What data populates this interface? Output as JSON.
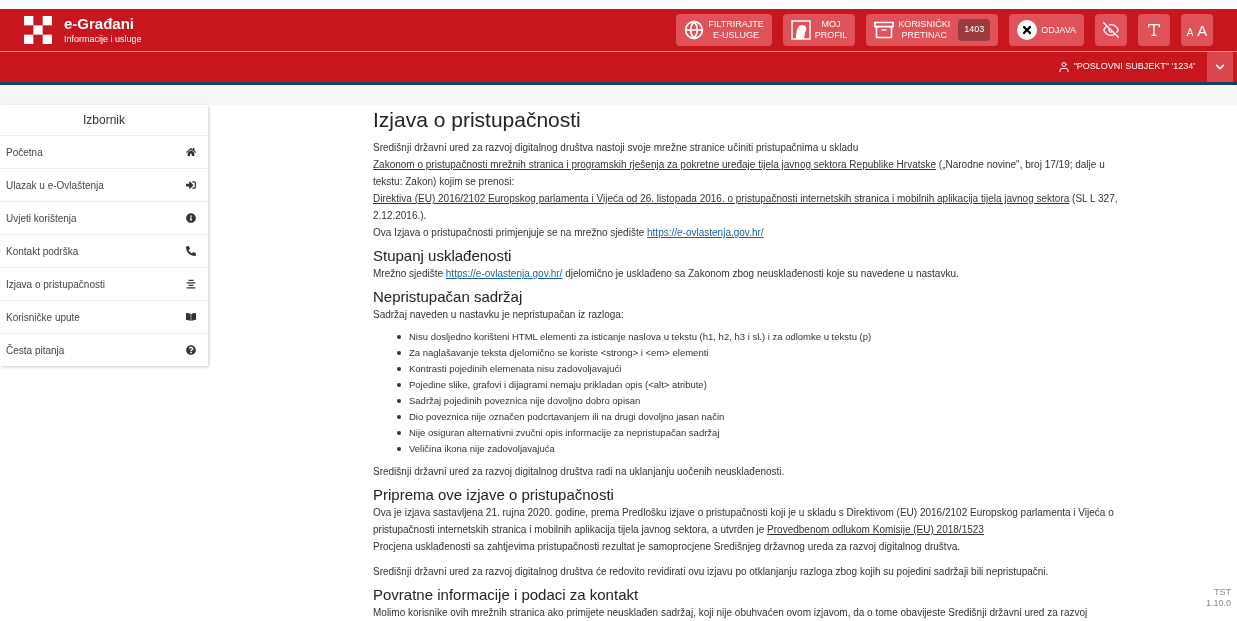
{
  "header": {
    "logo_title": "e-Građani",
    "logo_subtitle": "Informacije i usluge",
    "buttons": [
      {
        "kind": "filter",
        "lines": [
          "FILTRIRAJTE",
          "E-USLUGE"
        ]
      },
      {
        "kind": "profile",
        "lines": [
          "MOJ",
          "PROFIL"
        ]
      },
      {
        "kind": "inbox",
        "lines": [
          "KORISNIČKI",
          "PRETINAC"
        ],
        "badge": "1403"
      },
      {
        "kind": "logout",
        "lines": [
          "ODJAVA"
        ]
      },
      {
        "kind": "contrast"
      },
      {
        "kind": "font"
      },
      {
        "kind": "size",
        "small": "A",
        "large": "A"
      }
    ],
    "user": "\"POSLOVNI SUBJEKT\" '1234'"
  },
  "sidebar": {
    "title": "Izbornik",
    "items": [
      {
        "label": "Početna",
        "selected": false
      },
      {
        "label": "Ulazak u e-Ovlaštenja",
        "selected": false
      },
      {
        "label": "Uvjeti korištenja",
        "selected": false
      },
      {
        "label": "Kontakt podrška",
        "selected": false
      },
      {
        "label": "Izjava o pristupačnosti",
        "selected": false
      },
      {
        "label": "Korisničke upute",
        "selected": false
      },
      {
        "label": "Česta pitanja",
        "selected": false
      }
    ]
  },
  "content": {
    "title": "Izjava o pristupačnosti",
    "blocks": [
      {
        "kind": "para",
        "segments": [
          {
            "kind": "text",
            "text": "Središnji državni ured za razvoj digitalnog društva nastoji svoje mrežne stranice učiniti pristupačnima u skladu "
          },
          {
            "kind": "link",
            "text": "Zakonom o pristupačnosti mrežnih stranica i programskih rješenja za pokretne uređaje tijela javnog sektora Republike Hrvatske"
          },
          {
            "kind": "text",
            "text": " („Narodne novine\", broj 17/19; dalje u tekstu: Zakon) kojim se prenosi: "
          },
          {
            "kind": "link",
            "text": "Direktiva (EU) 2016/2102 Europskog parlamenta i Vijeća od 26. listopada 2016. o pristupačnosti internetskih stranica i mobilnih aplikacija tijela javnog sektora"
          },
          {
            "kind": "text",
            "text": " (SL L 327, 2.12.2016.)."
          }
        ]
      },
      {
        "kind": "para",
        "segments": [
          {
            "kind": "text",
            "text": "Ova Izjava o pristupačnosti primjenjuje se na mrežno sjedište "
          },
          {
            "kind": "url",
            "text": "https://e-ovlastenja.gov.hr/"
          }
        ]
      },
      {
        "kind": "heading",
        "text": "Stupanj usklađenosti"
      },
      {
        "kind": "para",
        "segments": [
          {
            "kind": "text",
            "text": "Mrežno sjedište "
          },
          {
            "kind": "url",
            "text": "https://e-ovlastenja.gov.hr/"
          },
          {
            "kind": "text",
            "text": " djelomično je usklađeno sa Zakonom zbog neusklađenosti koje su navedene u nastavku."
          }
        ]
      },
      {
        "kind": "heading",
        "text": "Nepristupačan sadržaj"
      },
      {
        "kind": "para",
        "segments": [
          {
            "kind": "text",
            "text": "Sadržaj naveden u nastavku je nepristupačan iz razloga:"
          }
        ]
      },
      {
        "kind": "list",
        "items": [
          "Nisu dosljedno korišteni HTML elementi za isticanje naslova u tekstu (h1, h2, h3 i sl.) i za odlomke u tekstu (p)",
          "Za naglašavanje teksta djelomično se koriste <strong> i <em> elementi",
          "Kontrasti pojedinih elemenata nisu zadovoljavajući",
          "Pojedine slike, grafovi i dijagrami nemaju prikladan opis (<alt> atribute)",
          "Sadržaj pojedinih poveznica nije dovoljno dobro opisan",
          "Dio poveznica nije označen podcrtavanjem ili na drugi dovoljno jasan način",
          "Nije osiguran alternativni zvučni opis informacije za nepristupačan sadržaj",
          "Veličina ikona nije zadovoljavajuća"
        ]
      },
      {
        "kind": "para",
        "segments": [
          {
            "kind": "text",
            "text": "Središnji državni ured za razvoj digitalnog društva radi na uklanjanju uočenih neusklađenosti."
          }
        ]
      },
      {
        "kind": "heading",
        "text": "Priprema ove izjave o pristupačnosti"
      },
      {
        "kind": "para",
        "segments": [
          {
            "kind": "text",
            "text": "Ova je izjava sastavljena 21. rujna 2020. godine, prema Predlošku izjave o pristupačnosti koji je u skladu s Direktivom (EU) 2016/2102 Europskog parlamenta i Vijeća o pristupačnosti internetskih stranica i mobilnih aplikacija tijela javnog sektora, a utvrđen je "
          },
          {
            "kind": "link",
            "text": "Provedbenom odlukom Komisije (EU) 2018/1523"
          }
        ]
      },
      {
        "kind": "para",
        "segments": [
          {
            "kind": "text",
            "text": "Procjena usklađenosti sa zahtjevima pristupačnosti rezultat je samoprocjene Središnjeg državnog ureda za razvoj digitalnog društva."
          }
        ]
      },
      {
        "kind": "gap"
      },
      {
        "kind": "para",
        "segments": [
          {
            "kind": "text",
            "text": "Središnji državni ured za razvoj digitalnog društva će redovito revidirati ovu izjavu po otklanjanju razloga zbog kojih su pojedini sadržaji bili nepristupačni."
          }
        ]
      },
      {
        "kind": "heading",
        "text": "Povratne informacije i podaci za kontakt"
      },
      {
        "kind": "para",
        "segments": [
          {
            "kind": "text",
            "text": "Molimo korisnike ovih mrežnih stranica ako primijete neusklađen sadržaj, koji nije obuhvaćen ovom izjavom, da o tome obavijeste Središnji državni ured za razvoj"
          }
        ]
      }
    ]
  },
  "version": {
    "env": "TST",
    "number": "1.10.0"
  }
}
